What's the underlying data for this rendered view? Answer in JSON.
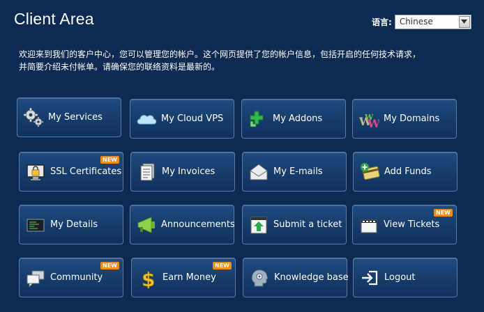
{
  "header": {
    "title": "Client Area"
  },
  "language": {
    "label": "语言:",
    "selected": "Chinese"
  },
  "welcome": {
    "line1": "欢迎来到我们的客户中心，您可以管理您的帐户。这个网页提供了您的帐户信息，包括开启的任何技术请求，",
    "line2": "并简要介绍未付帐单。请确保您的联络资料是最新的。"
  },
  "badge_text": "NEW",
  "tiles": [
    {
      "label": "My Services",
      "icon": "gears-icon",
      "selected": true,
      "is_new": false
    },
    {
      "label": "My Cloud VPS",
      "icon": "cloud-icon",
      "selected": false,
      "is_new": false
    },
    {
      "label": "My Addons",
      "icon": "puzzle-plus-icon",
      "selected": false,
      "is_new": false
    },
    {
      "label": "My Domains",
      "icon": "www-icon",
      "selected": false,
      "is_new": false
    },
    {
      "label": "SSL Certificates",
      "icon": "lock-monitor-icon",
      "selected": false,
      "is_new": true
    },
    {
      "label": "My Invoices",
      "icon": "document-icon",
      "selected": false,
      "is_new": false
    },
    {
      "label": "My E-mails",
      "icon": "envelope-icon",
      "selected": false,
      "is_new": false
    },
    {
      "label": "Add Funds",
      "icon": "credit-card-plus-icon",
      "selected": false,
      "is_new": false
    },
    {
      "label": "My Details",
      "icon": "terminal-icon",
      "selected": false,
      "is_new": false
    },
    {
      "label": "Announcements",
      "icon": "megaphone-icon",
      "selected": false,
      "is_new": false
    },
    {
      "label": "Submit a ticket",
      "icon": "upload-ticket-icon",
      "selected": false,
      "is_new": false
    },
    {
      "label": "View Tickets",
      "icon": "ticket-list-icon",
      "selected": false,
      "is_new": true
    },
    {
      "label": "Community",
      "icon": "chat-bubbles-icon",
      "selected": false,
      "is_new": true
    },
    {
      "label": "Earn Money",
      "icon": "dollar-icon",
      "selected": false,
      "is_new": true
    },
    {
      "label": "Knowledge base",
      "icon": "head-gear-icon",
      "selected": false,
      "is_new": false
    },
    {
      "label": "Logout",
      "icon": "logout-arrow-icon",
      "selected": false,
      "is_new": false
    }
  ]
}
